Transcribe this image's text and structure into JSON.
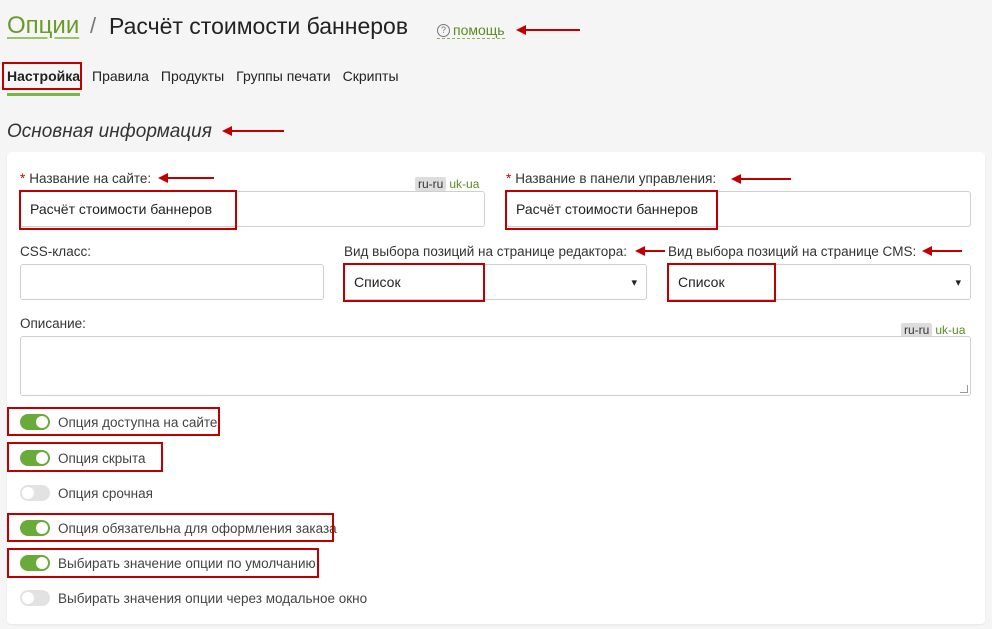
{
  "header": {
    "breadcrumb_root": "Опции",
    "breadcrumb_sep": "/",
    "title": "Расчёт стоимости баннеров",
    "help_icon": "?",
    "help_label": "помощь"
  },
  "tabs": [
    {
      "label": "Настройка",
      "active": true
    },
    {
      "label": "Правила"
    },
    {
      "label": "Продукты"
    },
    {
      "label": "Группы печати"
    },
    {
      "label": "Скрипты"
    }
  ],
  "section": {
    "title": "Основная информация"
  },
  "form": {
    "required_mark": "*",
    "site_name": {
      "label": "Название на сайте:",
      "value": "Расчёт стоимости баннеров"
    },
    "admin_name": {
      "label": "Название в панели управления:",
      "value": "Расчёт стоимости баннеров"
    },
    "css_class": {
      "label": "CSS-класс:",
      "value": ""
    },
    "editor_view": {
      "label": "Вид выбора позиций на странице редактора:",
      "value": "Список"
    },
    "cms_view": {
      "label": "Вид выбора позиций на странице CMS:",
      "value": "Список"
    },
    "description": {
      "label": "Описание:",
      "value": ""
    },
    "lang_current": "ru-ru",
    "lang_alt": "uk-ua",
    "select_caret": "▾"
  },
  "toggles": [
    {
      "label": "Опция доступна на сайте",
      "on": true
    },
    {
      "label": "Опция скрыта",
      "on": true
    },
    {
      "label": "Опция срочная",
      "on": false
    },
    {
      "label": "Опция обязательна для оформления заказа",
      "on": true
    },
    {
      "label": "Выбирать значение опции по умолчанию",
      "on": true
    },
    {
      "label": "Выбирать значения опции через модальное окно",
      "on": false
    }
  ],
  "colors": {
    "accent": "#6aaa3a",
    "annotation": "#c00000"
  }
}
